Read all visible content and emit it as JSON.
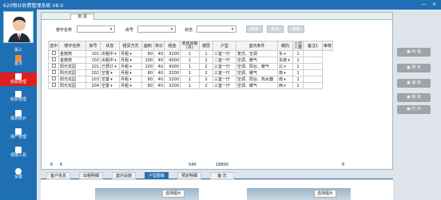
{
  "window": {
    "title": "620物业收费管理系统 V8.0",
    "minimize": "—",
    "close": "✕"
  },
  "user": {
    "name": "張三"
  },
  "sidebar": [
    {
      "label": "首页",
      "icon": "home-icon",
      "color": "#f08c2a"
    },
    {
      "label": "房源管理",
      "icon": "building-icon",
      "color": "#ffffff",
      "active": true
    },
    {
      "label": "收费管理",
      "icon": "billing-icon",
      "color": "#ffffff"
    },
    {
      "label": "报表统计",
      "icon": "report-icon",
      "color": "#ffffff"
    },
    {
      "label": "资产管理",
      "icon": "asset-icon",
      "color": "#ffffff"
    },
    {
      "label": "便捷工具",
      "icon": "tools-icon",
      "color": "#ffffff"
    },
    {
      "label": "设置",
      "icon": "gear-icon",
      "color": "#ffffff"
    }
  ],
  "tab": {
    "label": "房 源"
  },
  "search": {
    "building_label": "楼宇名称",
    "room_label": "房号",
    "status_label": "状态",
    "query_button": "查询",
    "cancel_button": "取消",
    "refresh_button": "刷新"
  },
  "table": {
    "headers": [
      "选中",
      "楼宇名称",
      "房号",
      "状态",
      "租赁方式",
      "面积",
      "单价",
      "租金",
      "收费周期(月)",
      "楼层",
      "户型",
      "室内条件",
      "朝向",
      "入住人数",
      "备注1",
      "审核"
    ],
    "rows": [
      [
        "金丽苑",
        "101",
        "出租中",
        "月租",
        "80",
        "40",
        "3200",
        "1",
        "1",
        "三室一厅",
        "复式、空调",
        "东",
        "1",
        ""
      ],
      [
        "金丽苑",
        "102",
        "出租中",
        "月租",
        "100",
        "40",
        "4000",
        "1",
        "2",
        "二室一厅",
        "空调、暖气",
        "东南",
        "1",
        ""
      ],
      [
        "阳光花园",
        "201",
        "已预订",
        "月租",
        "100",
        "40",
        "4000",
        "1",
        "2",
        "三室一厅",
        "空调、阳台、暖气",
        "北",
        "1",
        ""
      ],
      [
        "阳光花园",
        "202",
        "空置",
        "月租",
        "80",
        "40",
        "3200",
        "1",
        "2",
        "三室一厅",
        "空调、暖气",
        "南",
        "1",
        ""
      ],
      [
        "阳光花园",
        "203",
        "空置",
        "月租",
        "80",
        "40",
        "3200",
        "1",
        "2",
        "三室一厅",
        "空调、阳台、热水器",
        "南",
        "1",
        ""
      ],
      [
        "阳光花园",
        "204",
        "空置",
        "月租",
        "80",
        "40",
        "3200",
        "1",
        "2",
        "三室一厅",
        "空调、暖气",
        "西",
        "1",
        ""
      ]
    ],
    "footer": {
      "count_a": "6",
      "count_b": "6",
      "area_total": "540",
      "rent_total": "18800",
      "people_total": "6"
    }
  },
  "actions": [
    {
      "label": "出 租",
      "icon": "rent-icon"
    },
    {
      "label": "预 定",
      "icon": "reserve-icon"
    },
    {
      "label": "退 房",
      "icon": "checkout-icon"
    },
    {
      "label": "换 房",
      "icon": "swap-icon"
    },
    {
      "label": "打 印",
      "icon": "print-icon"
    }
  ],
  "bottom_tabs": [
    "客户信息",
    "出租明细",
    "室内设施",
    "户型图像",
    "预定明细",
    "备 忘"
  ],
  "bottom_active": "户型图像",
  "bottom": {
    "pick_image_1": "选择图片",
    "pick_image_2": "选择图片"
  },
  "colors": {
    "brand": "#1f6fb5",
    "active_nav": "#e01e1e",
    "accent_tab": "#2a6fb0"
  }
}
